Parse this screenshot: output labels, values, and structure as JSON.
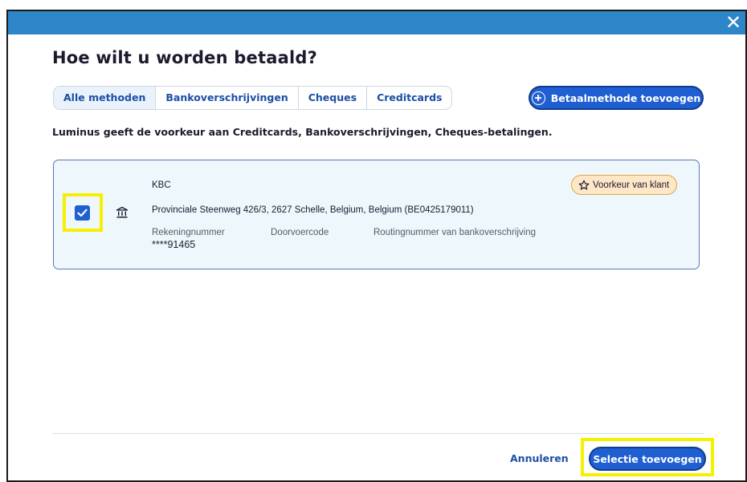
{
  "dialog": {
    "close_label": "✕",
    "title": "Hoe wilt u worden betaald?",
    "tabs": [
      {
        "label": "Alle methoden",
        "active": true
      },
      {
        "label": "Bankoverschrijvingen",
        "active": false
      },
      {
        "label": "Cheques",
        "active": false
      },
      {
        "label": "Creditcards",
        "active": false
      }
    ],
    "add_method_label": "Betaalmethode toevoegen",
    "preference_text": "Luminus geeft de voorkeur aan Creditcards, Bankoverschrijvingen, Cheques-betalingen."
  },
  "method": {
    "checked": true,
    "bank_name": "KBC",
    "address": "Provinciale Steenweg 426/3, 2627 Schelle, Belgium, Belgium (BE0425179011)",
    "fields": {
      "account_label": "Rekeningnummer",
      "routing_code_label": "Doorvoercode",
      "transfer_routing_label": "Routingnummer van bankoverschrijving"
    },
    "account_number": "****91465",
    "badge_label": "Voorkeur van klant"
  },
  "footer": {
    "cancel_label": "Annuleren",
    "submit_label": "Selectie toevoegen"
  },
  "colors": {
    "titlebar": "#2e86c9",
    "primary": "#1f5fd1",
    "highlight": "#f6f000",
    "card_bg": "#eef7fc",
    "badge_bg": "#fde7c6"
  },
  "icons": {
    "close": "close-icon",
    "add": "plus-circle-icon",
    "check": "checkmark-icon",
    "bank": "bank-icon",
    "star": "star-icon"
  }
}
